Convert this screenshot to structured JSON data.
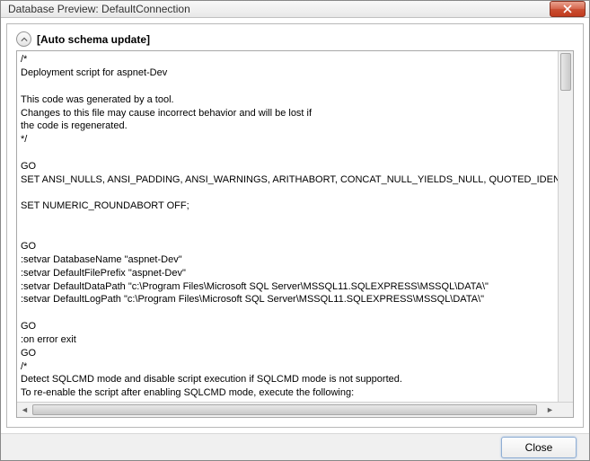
{
  "window": {
    "title": "Database Preview: DefaultConnection"
  },
  "section": {
    "title": "[Auto schema update]"
  },
  "script": {
    "text": "/*\nDeployment script for aspnet-Dev\n\nThis code was generated by a tool.\nChanges to this file may cause incorrect behavior and will be lost if\nthe code is regenerated.\n*/\n\nGO\nSET ANSI_NULLS, ANSI_PADDING, ANSI_WARNINGS, ARITHABORT, CONCAT_NULL_YIELDS_NULL, QUOTED_IDENTIFIER ON;\n\nSET NUMERIC_ROUNDABORT OFF;\n\n\nGO\n:setvar DatabaseName \"aspnet-Dev\"\n:setvar DefaultFilePrefix \"aspnet-Dev\"\n:setvar DefaultDataPath \"c:\\Program Files\\Microsoft SQL Server\\MSSQL11.SQLEXPRESS\\MSSQL\\DATA\\\"\n:setvar DefaultLogPath \"c:\\Program Files\\Microsoft SQL Server\\MSSQL11.SQLEXPRESS\\MSSQL\\DATA\\\"\n\nGO\n:on error exit\nGO\n/*\nDetect SQLCMD mode and disable script execution if SQLCMD mode is not supported.\nTo re-enable the script after enabling SQLCMD mode, execute the following:"
  },
  "footer": {
    "close_label": "Close"
  }
}
